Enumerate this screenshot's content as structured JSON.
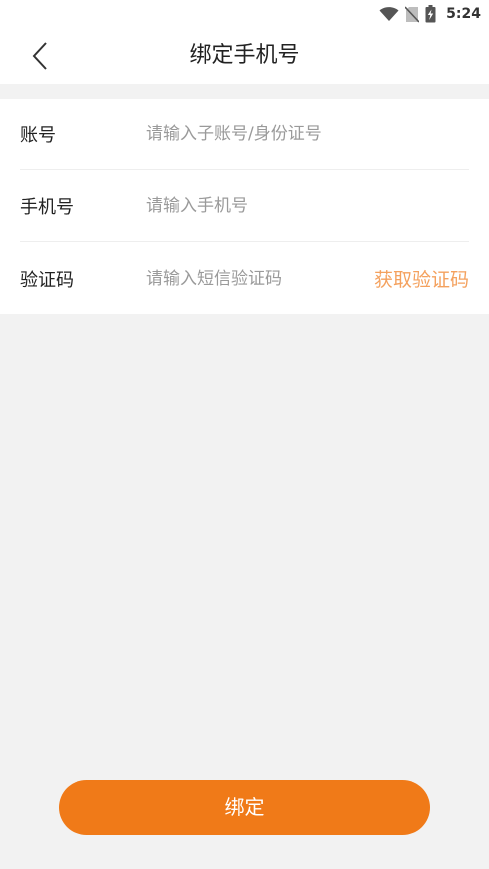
{
  "status_bar": {
    "time": "5:24",
    "icons": [
      "wifi-icon",
      "no-sim-icon",
      "battery-charging-icon"
    ]
  },
  "header": {
    "title": "绑定手机号",
    "back_icon": "chevron-left-icon"
  },
  "form": {
    "account": {
      "label": "账号",
      "placeholder": "请输入子账号/身份证号",
      "value": ""
    },
    "phone": {
      "label": "手机号",
      "placeholder": "请输入手机号",
      "value": ""
    },
    "code": {
      "label": "验证码",
      "placeholder": "请输入短信验证码",
      "value": "",
      "get_code_label": "获取验证码"
    }
  },
  "submit_label": "绑定",
  "colors": {
    "accent": "#f07a18",
    "get_code_text": "#f4a15e",
    "background": "#f2f2f2",
    "placeholder": "#9a9a9a"
  }
}
